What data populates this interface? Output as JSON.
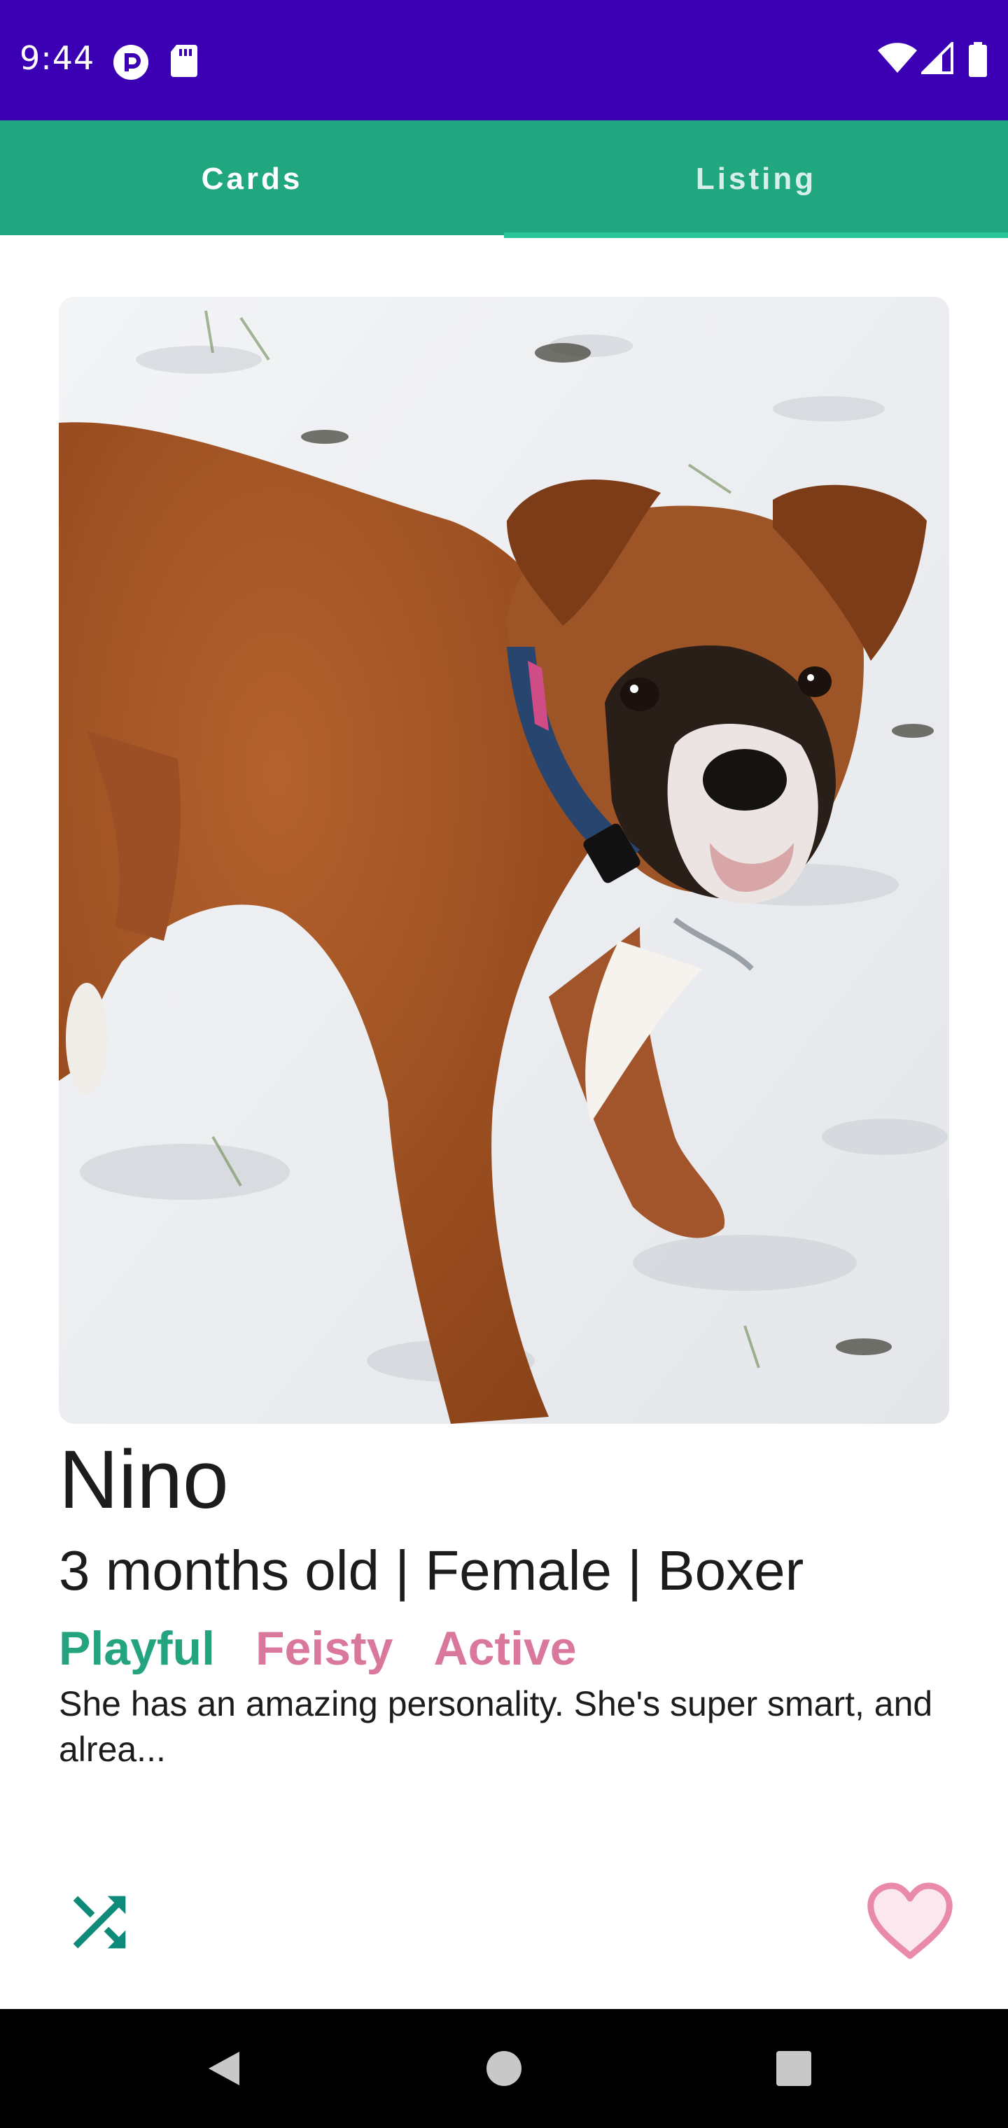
{
  "status_bar": {
    "time": "9:44",
    "left_icons": [
      "pocket-casts-icon",
      "sd-card-icon"
    ],
    "right_icons": [
      "wifi-icon",
      "cell-signal-icon",
      "battery-icon"
    ],
    "background_color": "#3c00b4"
  },
  "tabs": {
    "items": [
      {
        "label": "Cards",
        "selected": true
      },
      {
        "label": "Listing",
        "selected": false
      }
    ],
    "background_color": "#20a780"
  },
  "pet": {
    "photo_icon": "dog-photo",
    "name": "Nino",
    "info": "3 months old | Female | Boxer",
    "tags": [
      "Playful",
      "Feisty",
      "Active"
    ],
    "description": "She has an amazing personality. She's super smart, and alrea..."
  },
  "actions": {
    "shuffle_icon": "shuffle-icon",
    "like_icon": "heart-icon",
    "accent_color": "#0e8a7a",
    "heart_color": "#e88aa8"
  },
  "nav_bar": {
    "buttons": [
      "back-icon",
      "home-icon",
      "recents-icon"
    ]
  }
}
